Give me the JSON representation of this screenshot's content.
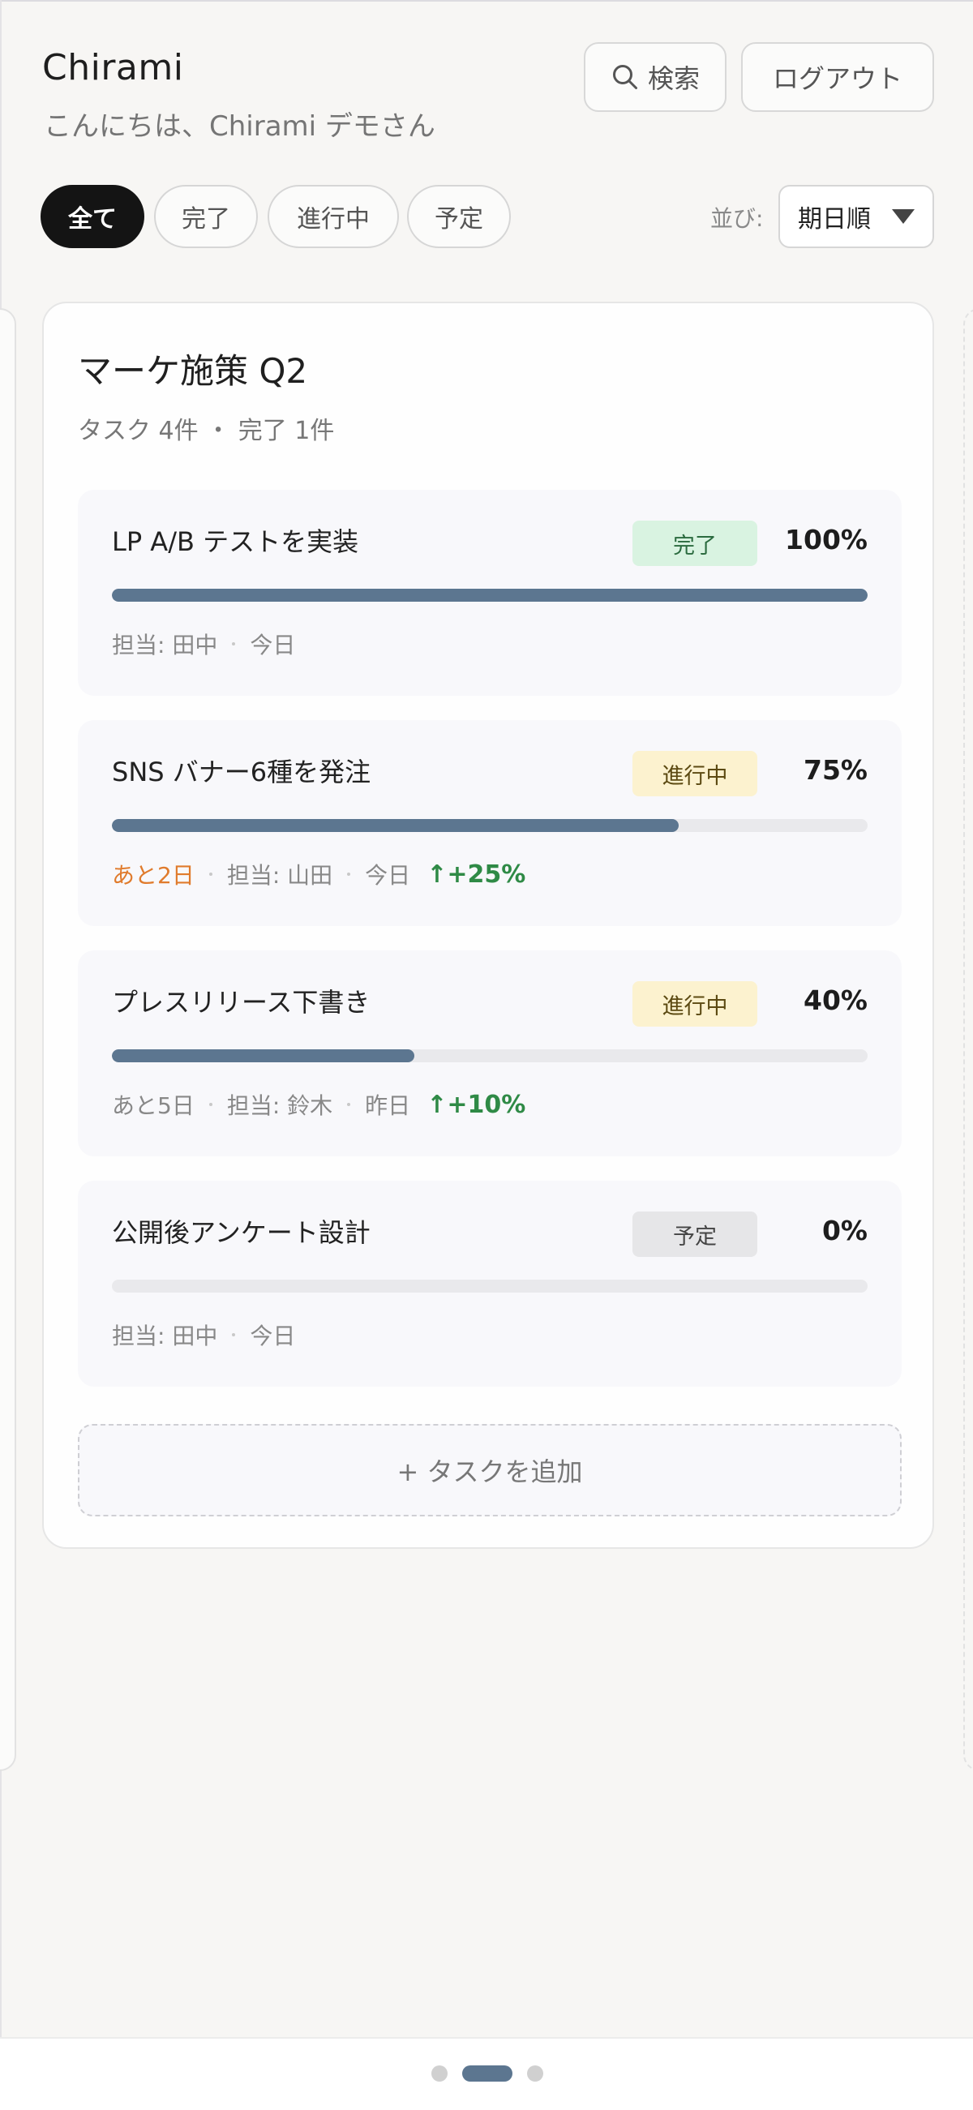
{
  "header": {
    "app_title": "Chirami",
    "greeting": "こんにちは、Chirami デモさん",
    "search_label": "検索",
    "logout_label": "ログアウト"
  },
  "filters": {
    "chips": [
      {
        "label": "全て",
        "active": true
      },
      {
        "label": "完了",
        "active": false
      },
      {
        "label": "進行中",
        "active": false
      },
      {
        "label": "予定",
        "active": false
      }
    ],
    "sort_label": "並び:",
    "sort_value": "期日順"
  },
  "project": {
    "title": "マーケ施策 Q2",
    "meta": "タスク 4件 ・ 完了 1件",
    "tasks": [
      {
        "name": "LP A/B テストを実装",
        "status": "完了",
        "percent_label": "100%",
        "progress": 1.0,
        "due": "",
        "assignee": "担当: 田中",
        "updated": "今日",
        "delta": ""
      },
      {
        "name": "SNS バナー6種を発注",
        "status": "進行中",
        "percent_label": "75%",
        "progress": 0.75,
        "due": "あと2日",
        "assignee": "担当: 山田",
        "updated": "今日",
        "delta": "↑+25%"
      },
      {
        "name": "プレスリリース下書き",
        "status": "進行中",
        "percent_label": "40%",
        "progress": 0.4,
        "due": "あと5日",
        "assignee": "担当: 鈴木",
        "updated": "昨日",
        "delta": "↑+10%"
      },
      {
        "name": "公開後アンケート設計",
        "status": "予定",
        "percent_label": "0%",
        "progress": 0.0,
        "due": "",
        "assignee": "担当: 田中",
        "updated": "今日",
        "delta": ""
      }
    ],
    "add_task_label": "+ タスクを追加"
  },
  "colors": {
    "accent": "#5c7690",
    "done_badge": "#d9f3e1",
    "progress_badge": "#fcf2cf",
    "planned_badge": "#e6e6e8",
    "urgent": "#e07b2c",
    "delta_up": "#2f8a46"
  },
  "pager": {
    "total_pages": 3,
    "current_page": 2
  }
}
